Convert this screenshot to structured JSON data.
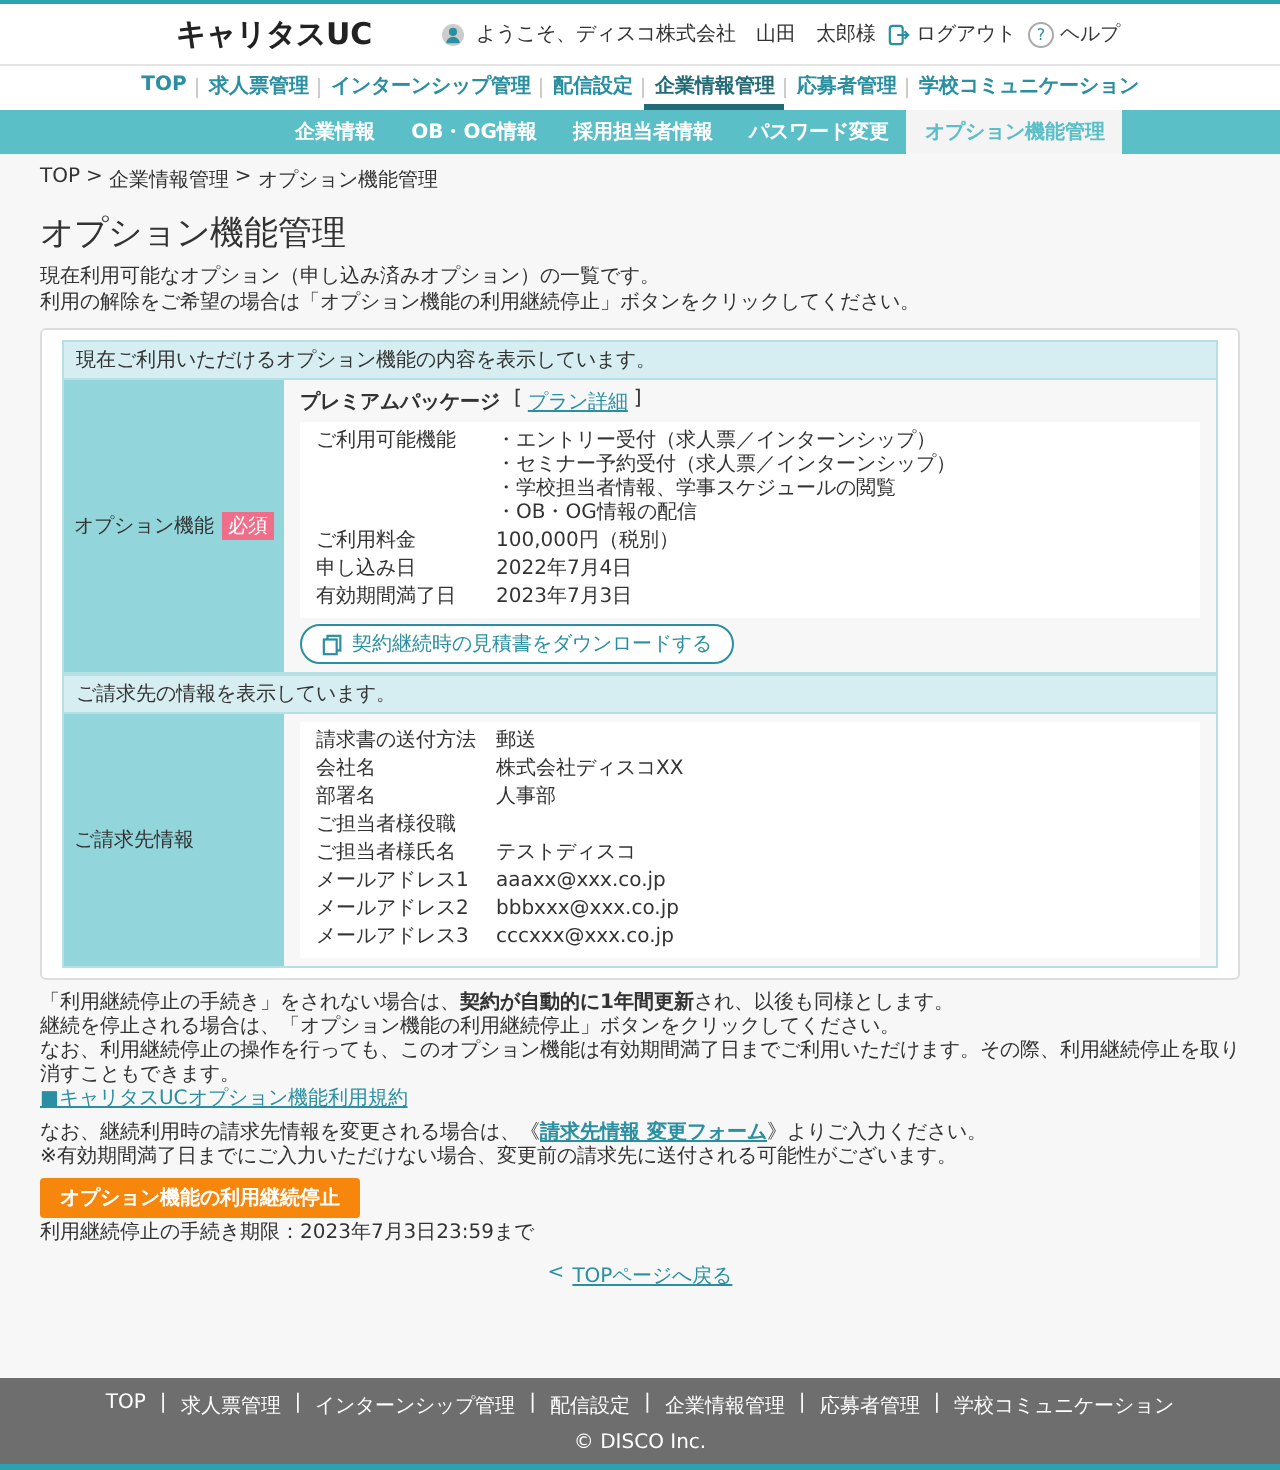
{
  "header": {
    "logo": "キャリタスUC",
    "welcome": "ようこそ、ディスコ株式会社　山田　太郎様",
    "logout": "ログアウト",
    "help_mark": "?",
    "help": "ヘルプ"
  },
  "nav": [
    {
      "label": "TOP",
      "selected": false
    },
    {
      "label": "求人票管理",
      "selected": false
    },
    {
      "label": "インターンシップ管理",
      "selected": false
    },
    {
      "label": "配信設定",
      "selected": false
    },
    {
      "label": "企業情報管理",
      "selected": true
    },
    {
      "label": "応募者管理",
      "selected": false
    },
    {
      "label": "学校コミュニケーション",
      "selected": false
    }
  ],
  "subnav": [
    {
      "label": "企業情報",
      "selected": false
    },
    {
      "label": "OB・OG情報",
      "selected": false
    },
    {
      "label": "採用担当者情報",
      "selected": false
    },
    {
      "label": "パスワード変更",
      "selected": false
    },
    {
      "label": "オプション機能管理",
      "selected": true
    }
  ],
  "breadcrumb": [
    "TOP",
    "企業情報管理",
    "オプション機能管理"
  ],
  "breadcrumb_sep": ">",
  "title": "オプション機能管理",
  "intro": [
    "現在利用可能なオプション（申し込み済みオプション）の一覧です。",
    "利用の解除をご希望の場合は「オプション機能の利用継続停止」ボタンをクリックしてください。"
  ],
  "option_section": {
    "caption": "現在ご利用いただけるオプション機能の内容を表示しています。",
    "label": "オプション機能",
    "required_badge": "必須",
    "package": "プレミアムパッケージ",
    "plan_link": "プラン詳細",
    "plan_brackets": [
      "[",
      "]"
    ],
    "rows": [
      {
        "label": "ご利用可能機能",
        "values": [
          "・エントリー受付（求人票／インターンシップ）",
          "・セミナー予約受付（求人票／インターンシップ）",
          "・学校担当者情報、学事スケジュールの閲覧",
          "・OB・OG情報の配信"
        ]
      },
      {
        "label": "ご利用料金",
        "values": [
          "100,000円（税別）"
        ]
      },
      {
        "label": "申し込み日",
        "values": [
          "2022年7月4日"
        ]
      },
      {
        "label": "有効期間満了日",
        "values": [
          "2023年7月3日"
        ]
      }
    ],
    "download_button": "契約継続時の見積書をダウンロードする"
  },
  "billing_section": {
    "caption": "ご請求先の情報を表示しています。",
    "label": "ご請求先情報",
    "rows": [
      {
        "label": "請求書の送付方法",
        "value": "郵送"
      },
      {
        "label": "会社名",
        "value": "株式会社ディスコXX"
      },
      {
        "label": "部署名",
        "value": "人事部"
      },
      {
        "label": "ご担当者様役職"
      },
      {
        "label": "ご担当者様氏名",
        "value": "テストディスコ"
      },
      {
        "label": "メールアドレス1",
        "value": "aaaxx@xxx.co.jp"
      },
      {
        "label": "メールアドレス2",
        "value": "bbbxxx@xxx.co.jp"
      },
      {
        "label": "メールアドレス3",
        "value": "cccxxx@xxx.co.jp"
      }
    ]
  },
  "notes": [
    "「利用継続停止の手続き」をされない場合は、**契約が自動的に1年間更新**され、以後も同様とします。",
    "継続を停止される場合は、「オプション機能の利用継続停止」ボタンをクリックしてください。",
    "なお、利用継続停止の操作を行っても、このオプション機能は有効期間満了日までご利用いただけます。その際、利用継続停止を取り消すこともできます。"
  ],
  "terms_link": "■キャリタスUCオプション機能利用規約",
  "change_note": {
    "before": "なお、継続利用時の請求先情報を変更される場合は、《",
    "link": "請求先情報 変更フォーム",
    "after": "》よりご入力ください。"
  },
  "change_caution": "※有効期間満了日までにご入力いただけない場合、変更前の請求先に送付される可能性がございます。",
  "stop_button": "オプション機能の利用継続停止",
  "deadline": "利用継続停止の手続き期限：2023年7月3日23:59まで",
  "back_link": {
    "mark": "<",
    "label": "TOPページへ戻る"
  },
  "footer": {
    "links": [
      "TOP",
      "求人票管理",
      "インターンシップ管理",
      "配信設定",
      "企業情報管理",
      "応募者管理",
      "学校コミュニケーション"
    ],
    "separator": "|",
    "copyright": "© DISCO Inc."
  }
}
